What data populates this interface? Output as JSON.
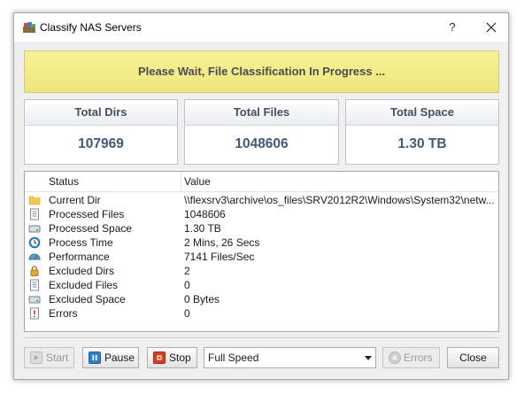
{
  "window": {
    "title": "Classify NAS Servers",
    "help_label": "?",
    "close_label": "×"
  },
  "banner": {
    "text": "Please Wait, File Classification In Progress ..."
  },
  "panels": [
    {
      "label": "Total Dirs",
      "value": "107969"
    },
    {
      "label": "Total Files",
      "value": "1048606"
    },
    {
      "label": "Total Space",
      "value": "1.30 TB"
    }
  ],
  "table": {
    "headers": {
      "status": "Status",
      "value": "Value"
    },
    "rows": [
      {
        "icon": "folder-icon",
        "status": "Current Dir",
        "value": "\\\\flexsrv3\\archive\\os_files\\SRV2012R2\\Windows\\System32\\netw..."
      },
      {
        "icon": "document-icon",
        "status": "Processed Files",
        "value": "1048606"
      },
      {
        "icon": "drive-icon",
        "status": "Processed Space",
        "value": "1.30 TB"
      },
      {
        "icon": "clock-icon",
        "status": "Process Time",
        "value": "2 Mins, 26 Secs"
      },
      {
        "icon": "gauge-icon",
        "status": "Performance",
        "value": "7141 Files/Sec"
      },
      {
        "icon": "lock-icon",
        "status": "Excluded Dirs",
        "value": "2"
      },
      {
        "icon": "document-icon",
        "status": "Excluded Files",
        "value": "0"
      },
      {
        "icon": "drive-icon",
        "status": "Excluded Space",
        "value": "0 Bytes"
      },
      {
        "icon": "error-icon",
        "status": "Errors",
        "value": "0"
      }
    ]
  },
  "toolbar": {
    "start_label": "Start",
    "pause_label": "Pause",
    "stop_label": "Stop",
    "speed_value": "Full Speed",
    "errors_label": "Errors",
    "close_label": "Close"
  },
  "colors": {
    "banner": "#f3ee8c",
    "accent_value": "#3f5a7a",
    "stop_red": "#e03a1e",
    "pause_blue": "#2f7fd1"
  }
}
